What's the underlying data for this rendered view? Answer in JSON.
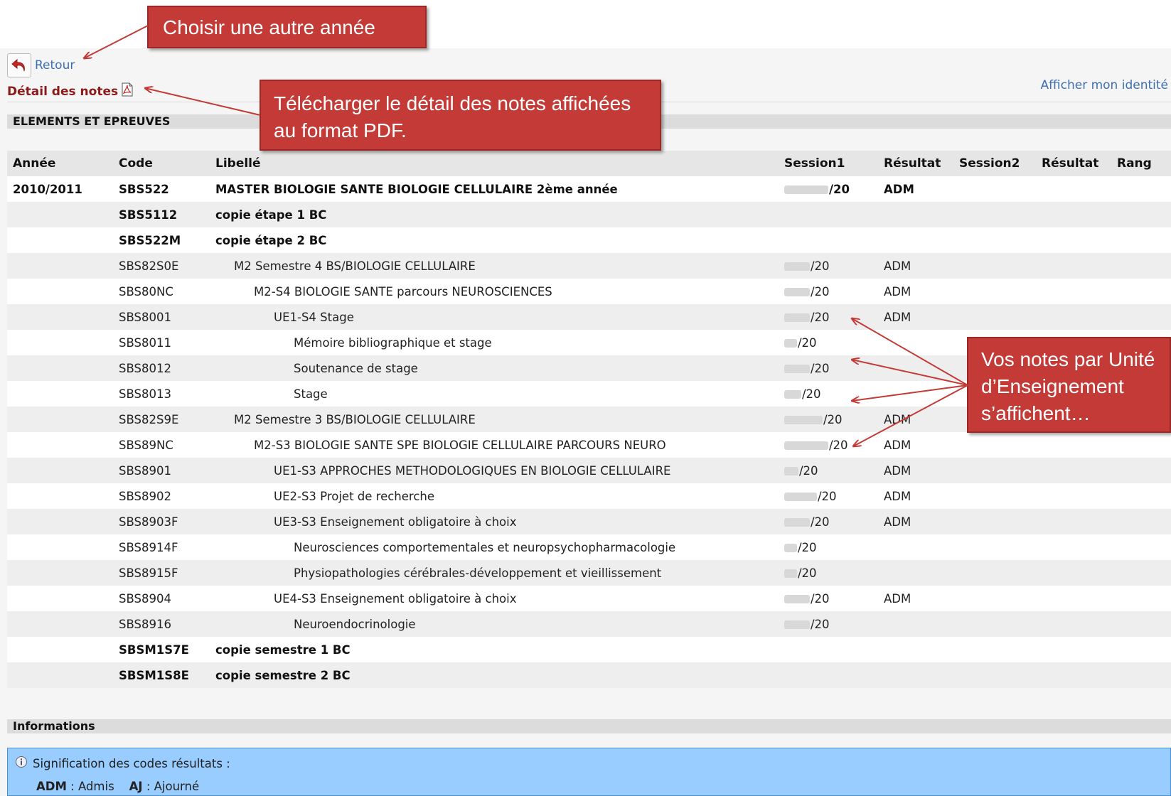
{
  "callouts": {
    "choose_year": "Choisir une autre année",
    "download_pdf": [
      "Télécharger le détail des notes affichées",
      "au format PDF."
    ],
    "notes_by_ue": [
      "Vos notes par Unité",
      "d’Enseignement",
      "s’affichent…"
    ]
  },
  "nav": {
    "retour_label": "Retour",
    "detail_title": "Détail des notes",
    "identite_link": "Afficher mon identité"
  },
  "section_elements": "ELEMENTS ET EPREUVES",
  "table": {
    "headers": [
      "Année",
      "Code",
      "Libellé",
      "Session1",
      "Résultat",
      "Session2",
      "Résultat",
      "Rang"
    ],
    "rows": [
      {
        "annee": "2010/2011",
        "code": "SBS522",
        "libelle": "MASTER BIOLOGIE SANTE BIOLOGIE CELLULAIRE 2ème année",
        "session1": "/20",
        "resultat": "ADM"
      },
      {
        "annee": "",
        "code": "SBS5112",
        "libelle": "copie étape 1 BC",
        "session1": "",
        "resultat": ""
      },
      {
        "annee": "",
        "code": "SBS522M",
        "libelle": "copie étape 2 BC",
        "session1": "",
        "resultat": ""
      },
      {
        "annee": "",
        "code": "SBS82S0E",
        "libelle": "M2 Semestre 4 BS/BIOLOGIE CELLULAIRE",
        "session1": "/20",
        "resultat": "ADM"
      },
      {
        "annee": "",
        "code": "SBS80NC",
        "libelle": "M2-S4 BIOLOGIE SANTE parcours NEUROSCIENCES",
        "session1": "/20",
        "resultat": "ADM"
      },
      {
        "annee": "",
        "code": "SBS8001",
        "libelle": "UE1-S4 Stage",
        "session1": "/20",
        "resultat": "ADM"
      },
      {
        "annee": "",
        "code": "SBS8011",
        "libelle": "Mémoire bibliographique et stage",
        "session1": "/20",
        "resultat": ""
      },
      {
        "annee": "",
        "code": "SBS8012",
        "libelle": "Soutenance de stage",
        "session1": "/20",
        "resultat": ""
      },
      {
        "annee": "",
        "code": "SBS8013",
        "libelle": "Stage",
        "session1": "/20",
        "resultat": ""
      },
      {
        "annee": "",
        "code": "SBS82S9E",
        "libelle": "M2 Semestre 3 BS/BIOLOGIE CELLULAIRE",
        "session1": "/20",
        "resultat": "ADM"
      },
      {
        "annee": "",
        "code": "SBS89NC",
        "libelle": "M2-S3 BIOLOGIE SANTE SPE BIOLOGIE CELLULAIRE PARCOURS NEURO",
        "session1": "/20",
        "resultat": "ADM"
      },
      {
        "annee": "",
        "code": "SBS8901",
        "libelle": "UE1-S3 APPROCHES METHODOLOGIQUES EN BIOLOGIE CELLULAIRE",
        "session1": "/20",
        "resultat": "ADM"
      },
      {
        "annee": "",
        "code": "SBS8902",
        "libelle": "UE2-S3 Projet de recherche",
        "session1": "/20",
        "resultat": "ADM"
      },
      {
        "annee": "",
        "code": "SBS8903F",
        "libelle": "UE3-S3 Enseignement obligatoire à choix",
        "session1": "/20",
        "resultat": "ADM"
      },
      {
        "annee": "",
        "code": "SBS8914F",
        "libelle": "Neurosciences comportementales et neuropsychopharmacologie",
        "session1": "/20",
        "resultat": ""
      },
      {
        "annee": "",
        "code": "SBS8915F",
        "libelle": "Physiopathologies cérébrales-développement et vieillissement",
        "session1": "/20",
        "resultat": ""
      },
      {
        "annee": "",
        "code": "SBS8904",
        "libelle": "UE4-S3 Enseignement obligatoire à choix",
        "session1": "/20",
        "resultat": "ADM"
      },
      {
        "annee": "",
        "code": "SBS8916",
        "libelle": "Neuroendocrinologie",
        "session1": "/20",
        "resultat": ""
      },
      {
        "annee": "",
        "code": "SBSM1S7E",
        "libelle": "copie semestre 1 BC",
        "session1": "",
        "resultat": ""
      },
      {
        "annee": "",
        "code": "SBSM1S8E",
        "libelle": "copie semestre 2 BC",
        "session1": "",
        "resultat": ""
      }
    ]
  },
  "section_informations": "Informations",
  "info": {
    "title": "Signification des codes résultats :",
    "adm_code": "ADM",
    "adm_label": " : Admis",
    "aj_code": "AJ",
    "aj_label": " : Ajourné"
  },
  "icons": {
    "retour": "undo-arrow-icon",
    "pdf": "pdf-file-icon",
    "info": "info-circle-icon"
  },
  "colors": {
    "callout_red": "#c43a37",
    "link_blue": "#3d6fb0",
    "title_red": "#8b1a1a",
    "info_blue": "#99ccff"
  }
}
